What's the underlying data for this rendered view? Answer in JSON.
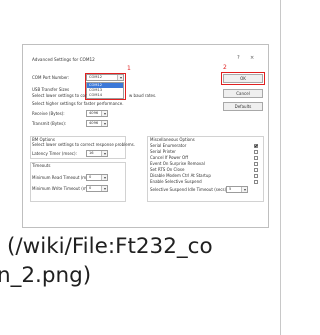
{
  "dialog": {
    "title": "Advanced Settings for COM12",
    "help_button": "?",
    "close_button": "×",
    "com_port_label": "COM Port Number:",
    "com_port_value": "COM12",
    "com_port_options": [
      "COM12",
      "COM13",
      "COM14"
    ],
    "usb_transfer_label": "USB Transfer Sizes",
    "usb_transfer_desc_before": "Select lower settings to cor",
    "usb_transfer_desc_after": "w baud rates.",
    "usb_transfer_desc2": "Select higher settings for faster performance.",
    "receive_label": "Receive (Bytes):",
    "receive_value": "4096",
    "transmit_label": "Transmit (Bytes):",
    "transmit_value": "4096",
    "bm_options_title": "BM Options",
    "bm_options_desc": "Select lower settings to correct response problems.",
    "latency_label": "Latency Timer (msec):",
    "latency_value": "16",
    "timeouts_title": "Timeouts",
    "min_read_label": "Minimum Read Timeout (msec):",
    "min_read_value": "0",
    "min_write_label": "Minimum Write Timeout (msec):",
    "min_write_value": "0",
    "misc_title": "Miscellaneous Options",
    "misc_options": [
      {
        "label": "Serial Enumerator",
        "checked": true
      },
      {
        "label": "Serial Printer",
        "checked": false
      },
      {
        "label": "Cancel If Power Off",
        "checked": false
      },
      {
        "label": "Event On Surprise Removal",
        "checked": false
      },
      {
        "label": "Set RTS On Close",
        "checked": false
      },
      {
        "label": "Disable Modem Ctrl At Startup",
        "checked": false
      },
      {
        "label": "Enable Selective Suspend",
        "checked": false
      }
    ],
    "selective_suspend_label": "Selective Suspend Idle Timeout (secs):",
    "selective_suspend_value": "5",
    "ok_button": "OK",
    "cancel_button": "Cancel",
    "defaults_button": "Defaults",
    "annotation_1": "1",
    "annotation_2": "2"
  },
  "caption": {
    "line1": "(/wiki/File:Ft232_co",
    "line2": "n_2.png)"
  },
  "colors": {
    "annotation_red": "#e02020",
    "selection_blue": "#3c78d8"
  }
}
